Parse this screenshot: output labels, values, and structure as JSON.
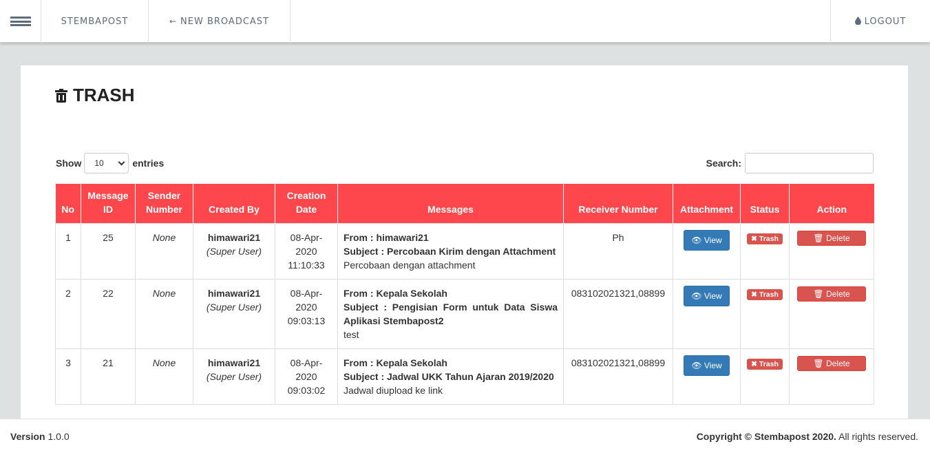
{
  "navbar": {
    "brand": "STEMBAPOST",
    "new_broadcast": "NEW BROADCAST",
    "new_broadcast_icon": "arrow-left-icon",
    "logout": "LOGOUT",
    "logout_icon": "droplet-icon"
  },
  "page": {
    "title": "TRASH",
    "title_icon": "trash-icon"
  },
  "controls": {
    "show_label": "Show",
    "entries_value": "10",
    "entries_label": "entries",
    "search_label": "Search:",
    "search_value": ""
  },
  "table": {
    "columns": {
      "no": "No",
      "message_id": "Message ID",
      "sender_number": "Sender Number",
      "created_by": "Created By",
      "creation_date": "Creation Date",
      "messages": "Messages",
      "receiver_number": "Receiver Number",
      "attachment": "Attachment",
      "status": "Status",
      "action": "Action"
    },
    "rows": [
      {
        "no": "1",
        "message_id": "25",
        "sender_number": "None",
        "created_by": "himawari21",
        "role": "(Super User)",
        "date": "08-Apr-",
        "year": "2020",
        "time": "11:10:33",
        "from": "From : himawari21",
        "subject": "Subject : Percobaan Kirim dengan Attachment",
        "body": "Percobaan dengan attachment",
        "receiver": "Ph",
        "view": "View",
        "status": "Trash",
        "delete": "Delete"
      },
      {
        "no": "2",
        "message_id": "22",
        "sender_number": "None",
        "created_by": "himawari21",
        "role": "(Super User)",
        "date": "08-Apr-",
        "year": "2020",
        "time": "09:03:13",
        "from": "From : Kepala Sekolah",
        "subject": "Subject : Pengisian Form untuk Data Siswa Aplikasi Stembapost2",
        "body": "test",
        "receiver": "083102021321,08899",
        "view": "View",
        "status": "Trash",
        "delete": "Delete"
      },
      {
        "no": "3",
        "message_id": "21",
        "sender_number": "None",
        "created_by": "himawari21",
        "role": "(Super User)",
        "date": "08-Apr-",
        "year": "2020",
        "time": "09:03:02",
        "from": "From : Kepala Sekolah",
        "subject": "Subject : Jadwal UKK Tahun Ajaran 2019/2020",
        "body": "Jadwal diupload ke link",
        "receiver": "083102021321,08899",
        "view": "View",
        "status": "Trash",
        "delete": "Delete"
      }
    ]
  },
  "footer": {
    "version_label": "Version",
    "version_value": "1.0.0",
    "copyright_bold": "Copyright © Stembapost 2020.",
    "copyright_rest": "All rights reserved."
  },
  "colors": {
    "table_header": "#fe474d",
    "view_button": "#337ab7",
    "danger": "#d9534f"
  }
}
